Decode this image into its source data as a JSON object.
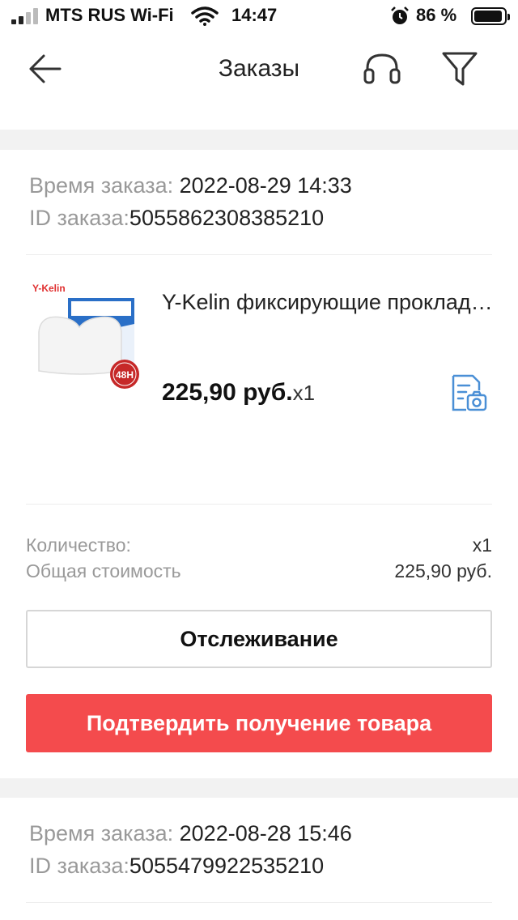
{
  "status_bar": {
    "carrier": "MTS RUS Wi-Fi",
    "time": "14:47",
    "battery": "86 %"
  },
  "header": {
    "title": "Заказы",
    "icons": [
      "back-arrow-icon",
      "headset-icon",
      "filter-icon"
    ]
  },
  "orders": [
    {
      "time_label": "Время заказа:",
      "time_value": " 2022-08-29 14:33",
      "id_label": "ID заказа:",
      "id_value": "5055862308385210",
      "product": {
        "brand_on_image": "Y-Kelin",
        "badge_on_image": "48H",
        "title": "Y-Kelin фиксирующие прокладки для зубных протезов",
        "price": "225,90 руб.",
        "qty": "x1"
      },
      "quantity_label": "Количество:",
      "quantity_value": "x1",
      "total_label": "Общая стоимость",
      "total_value": "225,90 руб.",
      "track_button": "Отслеживание",
      "confirm_button": "Подтвердить получение товара"
    },
    {
      "time_label": "Время заказа:",
      "time_value": " 2022-08-28 15:46",
      "id_label": "ID заказа:",
      "id_value": "5055479922535210"
    }
  ],
  "colors": {
    "accent_red": "#f44b4d",
    "icon_blue": "#4a8fd6",
    "separator": "#f2f2f2"
  }
}
